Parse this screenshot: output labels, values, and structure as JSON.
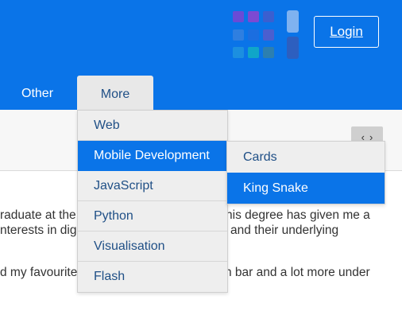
{
  "header": {
    "login_label": "Login",
    "logo_colors": [
      "#6a4bd6",
      "#7c4ad2",
      "#3a5fd0",
      "#2f7fe0",
      "#4b5fcf",
      "#3f5fb5",
      "#1c8fe0",
      "#10a6c8",
      "#2c7fb0",
      "#7fb2f0",
      "#2d5fbf"
    ]
  },
  "nav": {
    "items": [
      {
        "label": "Other"
      },
      {
        "label": "More"
      }
    ]
  },
  "carousel": {
    "prev_glyph": "‹",
    "next_glyph": "›"
  },
  "dropdown": {
    "items": [
      {
        "label": "Web",
        "active": false
      },
      {
        "label": "Mobile Development",
        "active": true
      },
      {
        "label": "JavaScript",
        "active": false
      },
      {
        "label": "Python",
        "active": false
      },
      {
        "label": "Visualisation",
        "active": false
      },
      {
        "label": "Flash",
        "active": false
      }
    ]
  },
  "submenu": {
    "items": [
      {
        "label": "Cards",
        "active": false
      },
      {
        "label": "King Snake",
        "active": true
      }
    ]
  },
  "content": {
    "lines": [
      "raduate at the",
      "his degree has given me a",
      "nterests in dig",
      "and their underlying",
      "d my favourite",
      "n bar and a lot more under"
    ]
  },
  "colors": {
    "brand_blue": "#0a74e8",
    "menu_bg": "#eeeeee",
    "menu_text": "#1f4f86"
  }
}
